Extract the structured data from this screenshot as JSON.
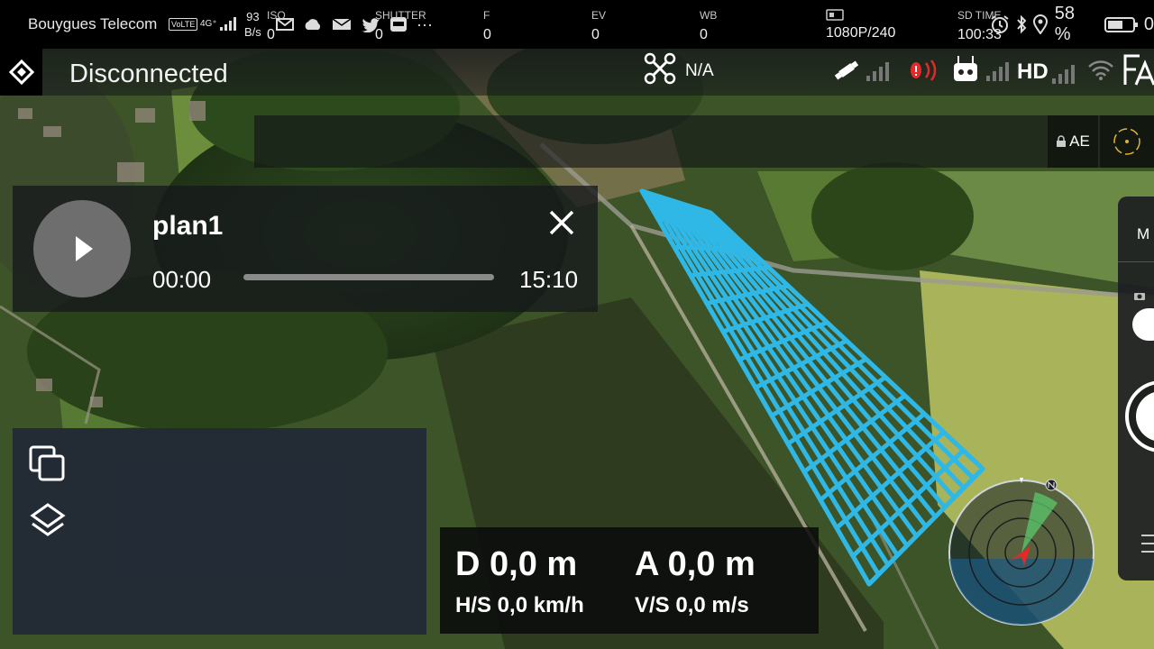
{
  "status_bar": {
    "carrier": "Bouygues Telecom",
    "volte_badge": "VoLTE",
    "network_type": "4G⁺",
    "data_rate_value": "93",
    "data_rate_unit": "B/s",
    "more": "···",
    "battery_percent": "58 %",
    "clock_partial": "0",
    "icons": [
      "mail-icon",
      "cloud-icon",
      "mail-icon",
      "twitter-icon",
      "inbox-icon",
      "alarm-icon",
      "bluetooth-icon",
      "location-icon",
      "battery-icon"
    ]
  },
  "top_bar": {
    "connection_status": "Disconnected",
    "drone_mode": "N/A",
    "hd_label": "HD"
  },
  "camera": {
    "params": [
      {
        "label": "ISO",
        "value": "0"
      },
      {
        "label": "SHUTTER",
        "value": "0"
      },
      {
        "label": "F",
        "value": "0"
      },
      {
        "label": "EV",
        "value": "0"
      },
      {
        "label": "WB",
        "value": "0"
      },
      {
        "label": "",
        "value": "1080P/240"
      },
      {
        "label": "SD TIME",
        "value": "100:33"
      }
    ],
    "ae_label": "AE"
  },
  "mission": {
    "name": "plan1",
    "elapsed": "00:00",
    "duration": "15:10",
    "progress": 0.0
  },
  "telemetry": {
    "distance": "D 0,0 m",
    "altitude": "A 0,0 m",
    "horizontal_speed": "H/S 0,0 km/h",
    "vertical_speed": "V/S 0,0 m/s"
  },
  "right_panel": {
    "mode_label": "M"
  },
  "colors": {
    "flight_path": "#2fb7e6",
    "alert_red": "#e32a2a",
    "radar_green": "#59c96b",
    "status_bar_bg": "#000000"
  }
}
